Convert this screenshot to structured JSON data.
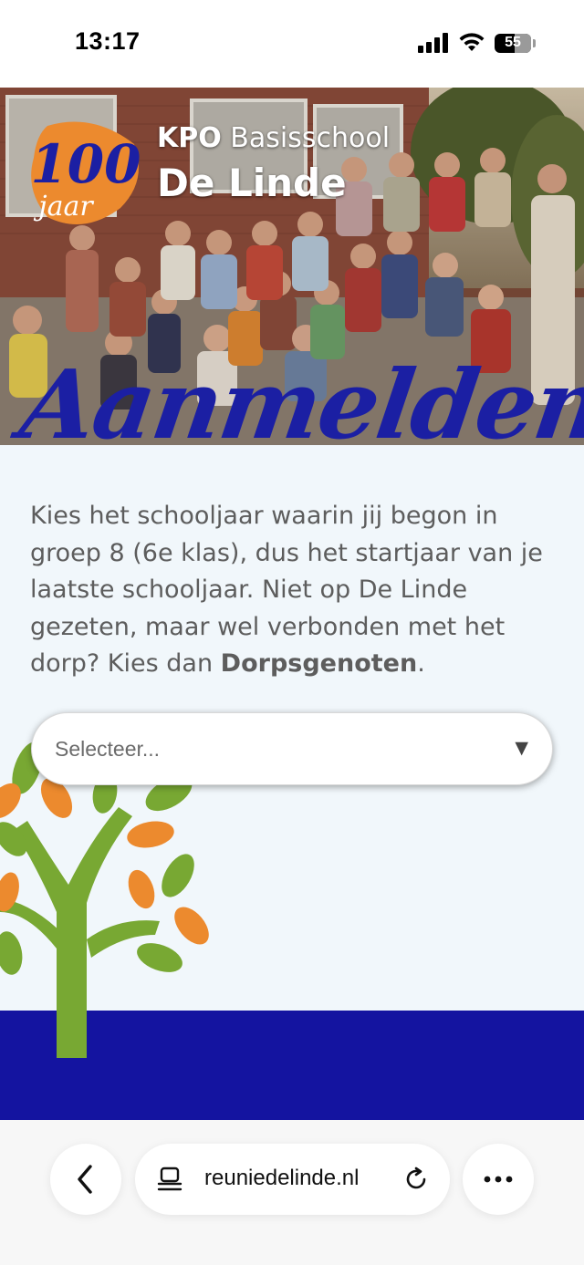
{
  "status_bar": {
    "time": "13:17",
    "battery": "55",
    "battery_level": 0.55
  },
  "hero": {
    "badge_text": "100 jaar",
    "school_prefix": "KPO",
    "school_type": "Basisschool",
    "school_name": "De Linde",
    "page_title": "Aanmelden"
  },
  "intro": {
    "text_before": "Kies het schooljaar waarin jij begon in groep 8 (6e klas), dus het startjaar van je laatste schooljaar. Niet op De Linde gezeten, maar wel verbonden met het dorp? Kies dan ",
    "bold_option": "Dorpsgenoten",
    "text_after": "."
  },
  "select": {
    "placeholder": "Selecteer...",
    "arrow_icon": "caret-down-icon"
  },
  "browser": {
    "url": "reuniedelinde.nl",
    "back_icon": "chevron-left-icon",
    "tabs_icon": "tabs-icon",
    "reload_icon": "reload-icon",
    "more_icon": "more-horizontal-icon"
  },
  "colors": {
    "brand_blue": "#1414a0",
    "script_blue": "#1b1fa3",
    "orange": "#ec8a2e",
    "green": "#78a833",
    "page_bg": "#f1f7fb"
  }
}
